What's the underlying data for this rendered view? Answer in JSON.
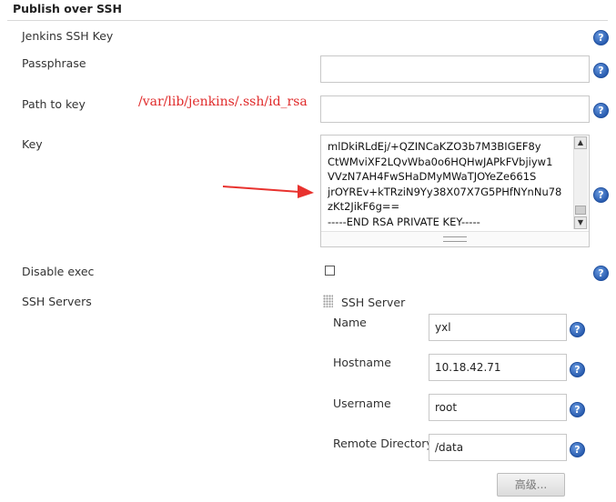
{
  "section": {
    "title": "Publish over SSH"
  },
  "fields": {
    "jenkins_ssh_key": {
      "label": "Jenkins SSH Key"
    },
    "passphrase": {
      "label": "Passphrase",
      "value": ""
    },
    "path_to_key": {
      "label": "Path to key",
      "value": "",
      "annotation": "/var/lib/jenkins/.ssh/id_rsa"
    },
    "key": {
      "label": "Key",
      "value": "mlDkiRLdEj/+QZINCaKZO3b7M3BIGEF8y\nCtWMviXF2LQvWba0o6HQHwJAPkFVbjiyw1\nVVzN7AH4FwSHaDMyMWaTJOYeZe661S\njrOYREv+kTRziN9Yy38X07X7G5PHfNYnNu78\nzKt2JikF6g==\n-----END RSA PRIVATE KEY-----"
    },
    "disable_exec": {
      "label": "Disable exec",
      "checked": false
    },
    "ssh_servers": {
      "label": "SSH Servers"
    }
  },
  "ssh_server": {
    "title": "SSH Server",
    "name": {
      "label": "Name",
      "value": "yxl"
    },
    "hostname": {
      "label": "Hostname",
      "value": "10.18.42.71"
    },
    "username": {
      "label": "Username",
      "value": "root"
    },
    "remote_directory": {
      "label": "Remote Directory",
      "value": "/data"
    },
    "advanced_button": "高级..."
  },
  "icons": {
    "help": "?"
  },
  "colors": {
    "help_blue": "#2a5db0",
    "annotation_red": "#e02a2a"
  }
}
